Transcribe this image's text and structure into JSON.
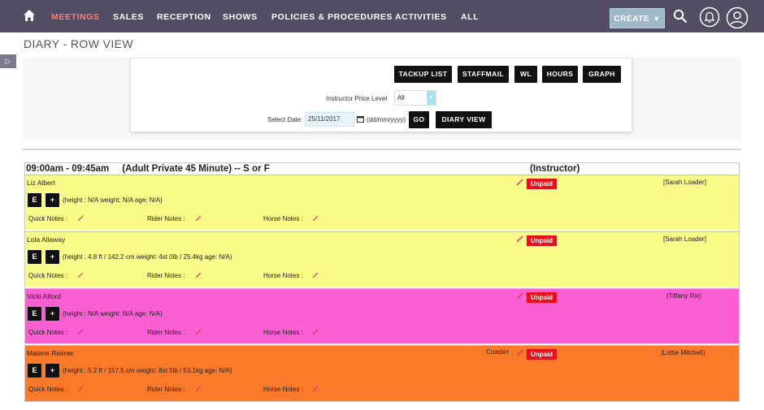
{
  "nav": {
    "items": [
      "MEETINGS",
      "SALES",
      "RECEPTION",
      "SHOWS",
      "POLICIES & PROCEDURES",
      "ACTIVITIES",
      "ALL"
    ],
    "create_label": "CREATE",
    "active_color": "#f08377",
    "bar_color": "#534d64"
  },
  "page": {
    "title": "DIARY - ROW VIEW",
    "side_toggle": "▷"
  },
  "toolbar": {
    "buttons": [
      "TACKUP LIST",
      "STAFFMAIL",
      "WL",
      "HOURS",
      "GRAPH"
    ],
    "price_level_label": "Instructor Price Level",
    "price_level_value": "All",
    "select_date_label": "Select Date",
    "date_value": "25/11/2017",
    "date_format": "(dd/mm/yyyy)",
    "go_label": "GO",
    "diary_view_label": "DIARY VIEW"
  },
  "slot": {
    "time": "09:00am - 09:45am",
    "lesson": "(Adult Private 45 Minute) -- S or F",
    "instructor_heading": "(Instructor)"
  },
  "labels": {
    "quick_notes": "Quick Notes :",
    "rider_notes": "Rider Notes :",
    "horse_notes": "Horse Notes :",
    "unpaid": "Unpaid",
    "edit_button": "E",
    "add_button": "+"
  },
  "rows": [
    {
      "name": "Liz Albert",
      "horse": "",
      "metrics": "(height : N/A weight: N/A age: N/A)",
      "instructor": "[Sarah Loader]",
      "color": "#fbfb8a"
    },
    {
      "name": "Lola Allaway",
      "horse": "",
      "metrics": "(height : 4.8 ft / 142.2 cm weight: 4st 0lb / 25.4kg age: N/A)",
      "instructor": "[Sarah Loader]",
      "color": "#fbfb8a"
    },
    {
      "name": "Vicki Alford",
      "horse": "",
      "metrics": "(height : N/A weight: N/A age: N/A)",
      "instructor": "(Tiffany Rix)",
      "color": "#fb5fd3"
    },
    {
      "name": "Malene Reimer",
      "horse": "Coaster",
      "metrics": "(height : 5.2 ft / 157.5 cm weight: 8st 5lb / 53.1kg age: N/A)",
      "instructor": "(Lottie Mitchell)",
      "color": "#fb7a2a"
    }
  ]
}
